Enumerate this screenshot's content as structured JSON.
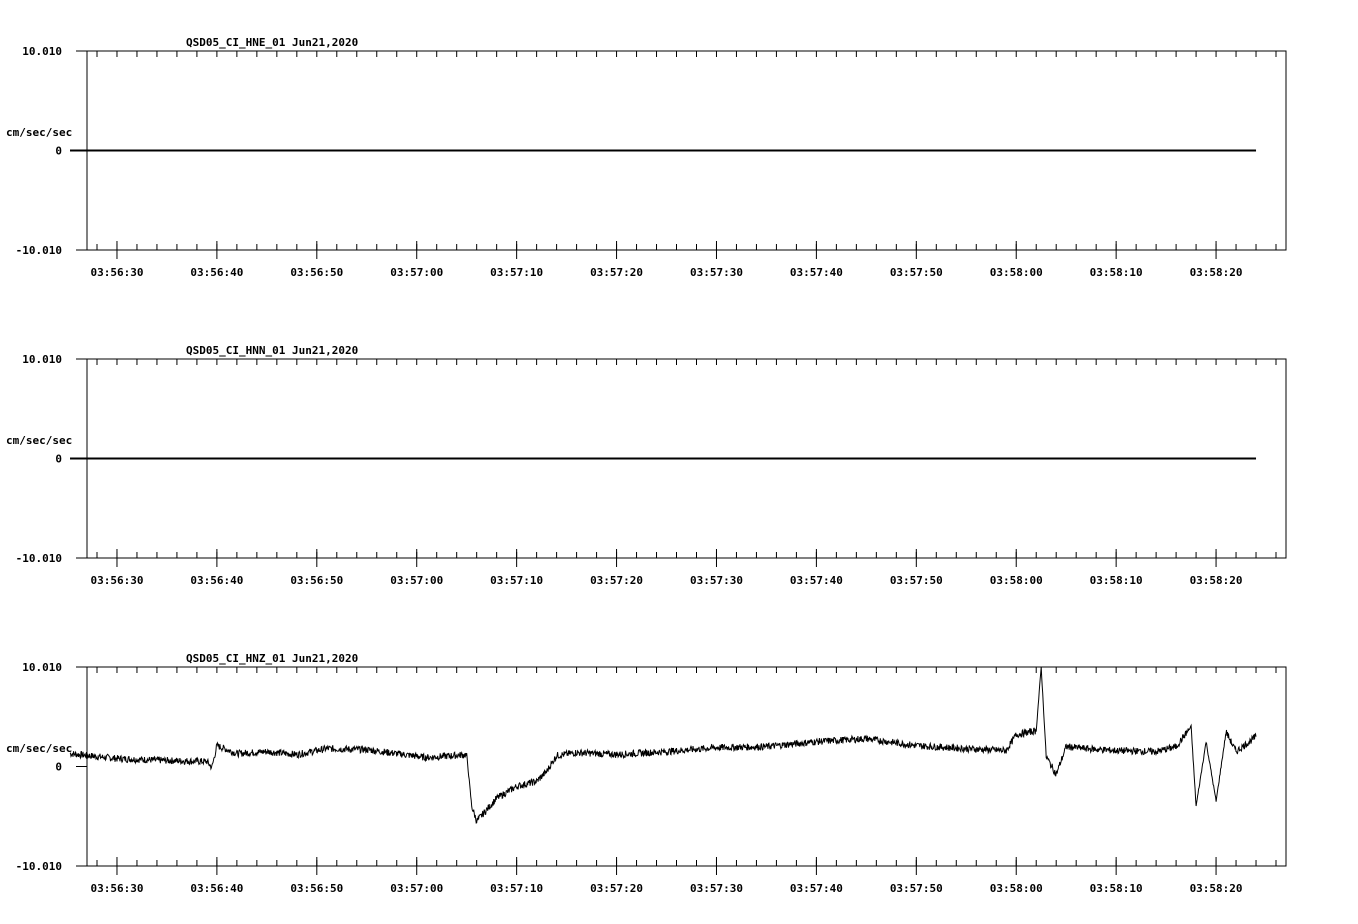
{
  "chart_data": [
    {
      "type": "line",
      "title": "QSD05_CI_HNE_01  Jun21,2020",
      "ylabel": "cm/sec/sec",
      "ylim": [
        -10.01,
        10.01
      ],
      "ytick_labels": [
        "10.010",
        "0",
        "-10.010"
      ],
      "xlim_seconds": [
        -3,
        117
      ],
      "xtick_labels": [
        "03:56:30",
        "03:56:40",
        "03:56:50",
        "03:57:00",
        "03:57:10",
        "03:57:20",
        "03:57:30",
        "03:57:40",
        "03:57:50",
        "03:58:00",
        "03:58:10",
        "03:58:20"
      ],
      "series": [
        {
          "x": [
            "03:56:25.3",
            "03:58:24"
          ],
          "values": [
            0,
            0
          ]
        }
      ]
    },
    {
      "type": "line",
      "title": "QSD05_CI_HNN_01  Jun21,2020",
      "ylabel": "cm/sec/sec",
      "ylim": [
        -10.01,
        10.01
      ],
      "ytick_labels": [
        "10.010",
        "0",
        "-10.010"
      ],
      "xlim_seconds": [
        -3,
        117
      ],
      "xtick_labels": [
        "03:56:30",
        "03:56:40",
        "03:56:50",
        "03:57:00",
        "03:57:10",
        "03:57:20",
        "03:57:30",
        "03:57:40",
        "03:57:50",
        "03:58:00",
        "03:58:10",
        "03:58:20"
      ],
      "series": [
        {
          "x": [
            "03:56:25.3",
            "03:58:24"
          ],
          "values": [
            0,
            0
          ]
        }
      ]
    },
    {
      "type": "line",
      "title": "QSD05_CI_HNZ_01  Jun21,2020",
      "ylabel": "cm/sec/sec",
      "ylim": [
        -10.01,
        10.01
      ],
      "ytick_labels": [
        "10.010",
        "0",
        "-10.010"
      ],
      "xlim_seconds": [
        -3,
        117
      ],
      "xtick_labels": [
        "03:56:30",
        "03:56:40",
        "03:56:50",
        "03:57:00",
        "03:57:10",
        "03:57:20",
        "03:57:30",
        "03:57:40",
        "03:57:50",
        "03:58:00",
        "03:58:10",
        "03:58:20"
      ],
      "series": [
        {
          "x": [
            "03:56:25.3",
            "03:56:28",
            "03:56:30",
            "03:56:35",
            "03:56:39",
            "03:56:39.5",
            "03:56:40",
            "03:56:42",
            "03:56:45",
            "03:56:48",
            "03:56:51",
            "03:56:55",
            "03:56:58",
            "03:57:01",
            "03:57:05",
            "03:57:05.5",
            "03:57:06",
            "03:57:08",
            "03:57:10",
            "03:57:12",
            "03:57:13",
            "03:57:14",
            "03:57:16",
            "03:57:20",
            "03:57:25",
            "03:57:30",
            "03:57:35",
            "03:57:40",
            "03:57:45",
            "03:57:50",
            "03:57:55",
            "03:57:59",
            "03:58:00",
            "03:58:02",
            "03:58:02.5",
            "03:58:03",
            "03:58:04",
            "03:58:05",
            "03:58:07",
            "03:58:10",
            "03:58:14",
            "03:58:16",
            "03:58:17.5",
            "03:58:18",
            "03:58:19",
            "03:58:20",
            "03:58:21",
            "03:58:22",
            "03:58:24"
          ],
          "values": [
            1.3,
            1.0,
            0.8,
            0.6,
            0.5,
            -0.1,
            2.1,
            1.3,
            1.5,
            1.2,
            1.8,
            1.7,
            1.3,
            0.9,
            1.2,
            -4.0,
            -5.5,
            -3.2,
            -2.0,
            -1.5,
            -0.5,
            1.1,
            1.4,
            1.2,
            1.5,
            1.9,
            2.0,
            2.5,
            2.8,
            2.1,
            1.8,
            1.6,
            3.2,
            3.6,
            10.0,
            1.0,
            -0.8,
            2.0,
            1.8,
            1.6,
            1.5,
            2.0,
            4.0,
            -4.0,
            2.5,
            -3.5,
            3.5,
            1.5,
            3.0
          ]
        }
      ]
    }
  ]
}
